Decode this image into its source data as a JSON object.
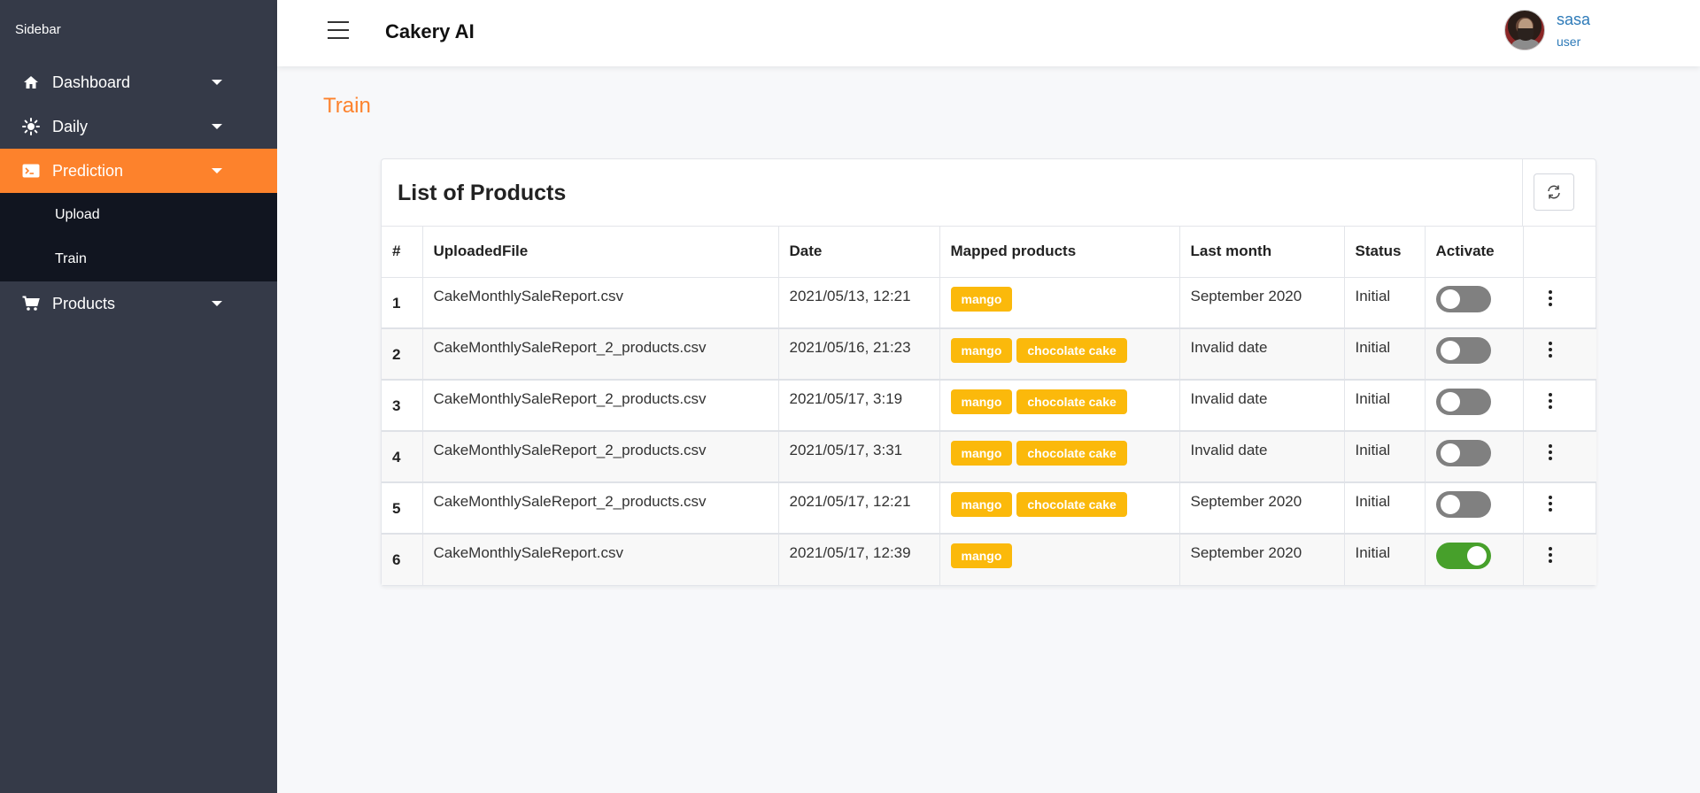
{
  "sidebar": {
    "title": "Sidebar",
    "items": [
      {
        "label": "Dashboard",
        "icon": "home-icon"
      },
      {
        "label": "Daily",
        "icon": "sun-icon"
      },
      {
        "label": "Prediction",
        "icon": "terminal-icon"
      },
      {
        "label": "Products",
        "icon": "cart-icon"
      }
    ],
    "submenu": [
      {
        "label": "Upload"
      },
      {
        "label": "Train"
      }
    ]
  },
  "header": {
    "app_title": "Cakery AI",
    "user_name": "sasa",
    "user_role": "user"
  },
  "page": {
    "title": "Train"
  },
  "card": {
    "title": "List of Products",
    "columns": [
      "#",
      "UploadedFile",
      "Date",
      "Mapped products",
      "Last month",
      "Status",
      "Activate"
    ],
    "rows": [
      {
        "num": "1",
        "file": "CakeMonthlySaleReport.csv",
        "date": "2021/05/13, 12:21",
        "products": [
          "mango"
        ],
        "last_month": "September 2020",
        "status": "Initial",
        "active": false
      },
      {
        "num": "2",
        "file": "CakeMonthlySaleReport_2_products.csv",
        "date": "2021/05/16, 21:23",
        "products": [
          "mango",
          "chocolate cake"
        ],
        "last_month": "Invalid date",
        "status": "Initial",
        "active": false
      },
      {
        "num": "3",
        "file": "CakeMonthlySaleReport_2_products.csv",
        "date": "2021/05/17, 3:19",
        "products": [
          "mango",
          "chocolate cake"
        ],
        "last_month": "Invalid date",
        "status": "Initial",
        "active": false
      },
      {
        "num": "4",
        "file": "CakeMonthlySaleReport_2_products.csv",
        "date": "2021/05/17, 3:31",
        "products": [
          "mango",
          "chocolate cake"
        ],
        "last_month": "Invalid date",
        "status": "Initial",
        "active": false
      },
      {
        "num": "5",
        "file": "CakeMonthlySaleReport_2_products.csv",
        "date": "2021/05/17, 12:21",
        "products": [
          "mango",
          "chocolate cake"
        ],
        "last_month": "September 2020",
        "status": "Initial",
        "active": false
      },
      {
        "num": "6",
        "file": "CakeMonthlySaleReport.csv",
        "date": "2021/05/17, 12:39",
        "products": [
          "mango"
        ],
        "last_month": "September 2020",
        "status": "Initial",
        "active": true
      }
    ]
  },
  "colors": {
    "accent": "#fd822c",
    "sidebar_bg": "#353a48",
    "submenu_bg": "#111520",
    "badge": "#fbb90b",
    "toggle_on": "#47a02b",
    "toggle_off": "#808080",
    "link": "#2d7ab8"
  }
}
